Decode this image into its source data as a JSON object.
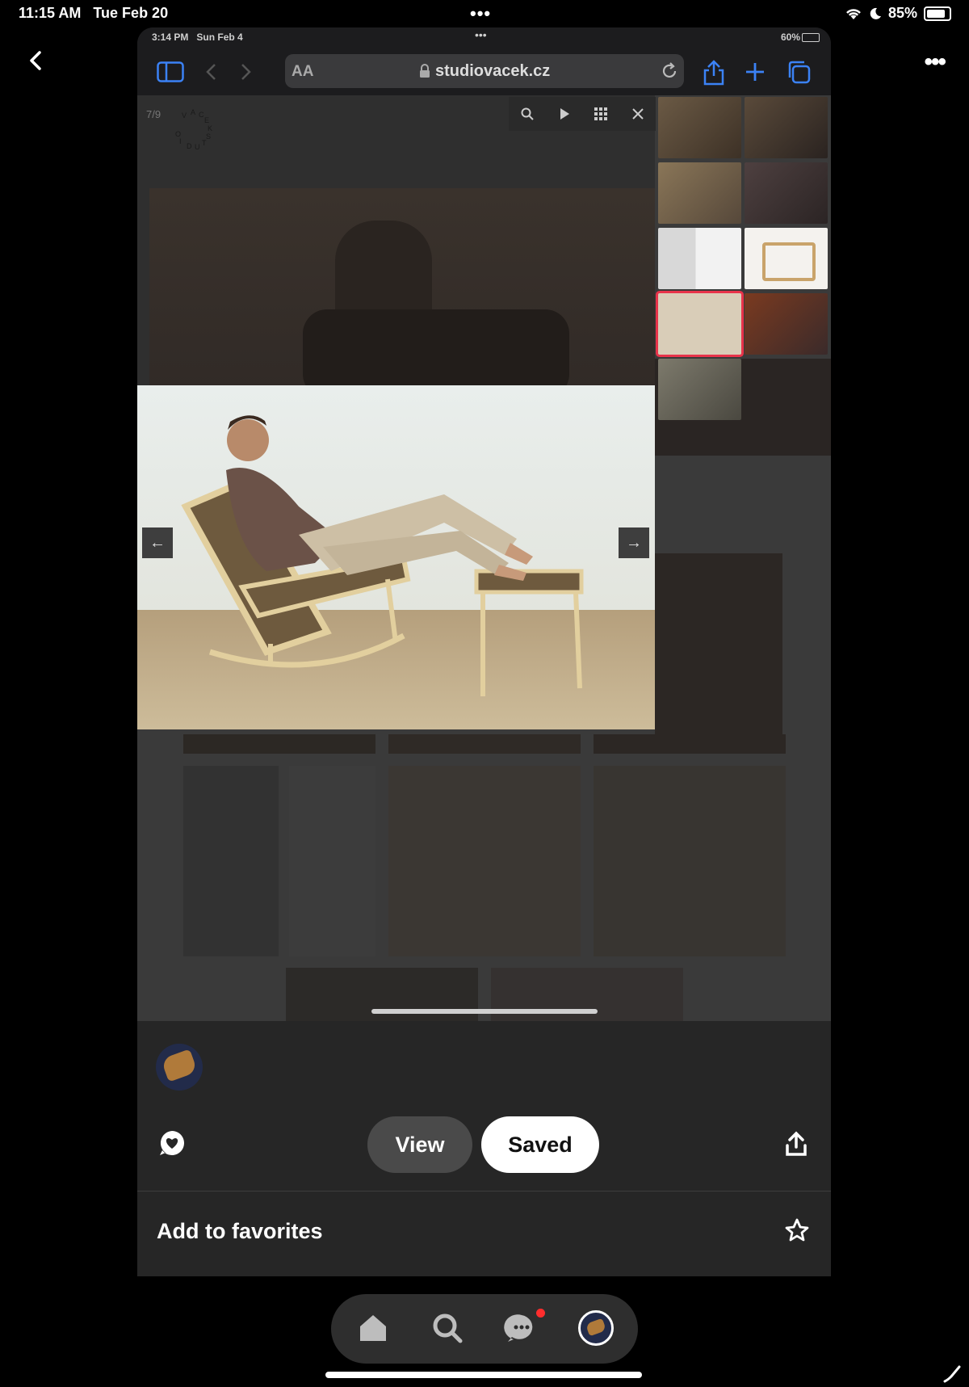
{
  "status_bar": {
    "time": "11:15 AM",
    "date": "Tue Feb 20",
    "battery": "85%"
  },
  "inner_status": {
    "time": "3:14 PM",
    "date": "Sun Feb 4",
    "battery": "60%"
  },
  "browser": {
    "text_size": "AA",
    "url": "studiovacek.cz"
  },
  "lightbox": {
    "counter": "7/9",
    "logo_letters": "VACEK STUDIO"
  },
  "actions": {
    "view_label": "View",
    "saved_label": "Saved"
  },
  "favorites": {
    "label": "Add to favorites"
  },
  "colors": {
    "selected_thumb_border": "#e8334a",
    "notification_dot": "#ff2d2d",
    "saved_bg": "#ffffff",
    "view_bg": "#4a4a4a"
  },
  "icons": [
    "back-chevron-icon",
    "more-icon",
    "sidebar-icon",
    "search-icon",
    "play-icon",
    "grid-icon",
    "close-icon",
    "arrow-left-icon",
    "arrow-right-icon",
    "comment-icon",
    "share-icon",
    "star-icon",
    "home-icon",
    "messages-icon",
    "profile-icon"
  ]
}
